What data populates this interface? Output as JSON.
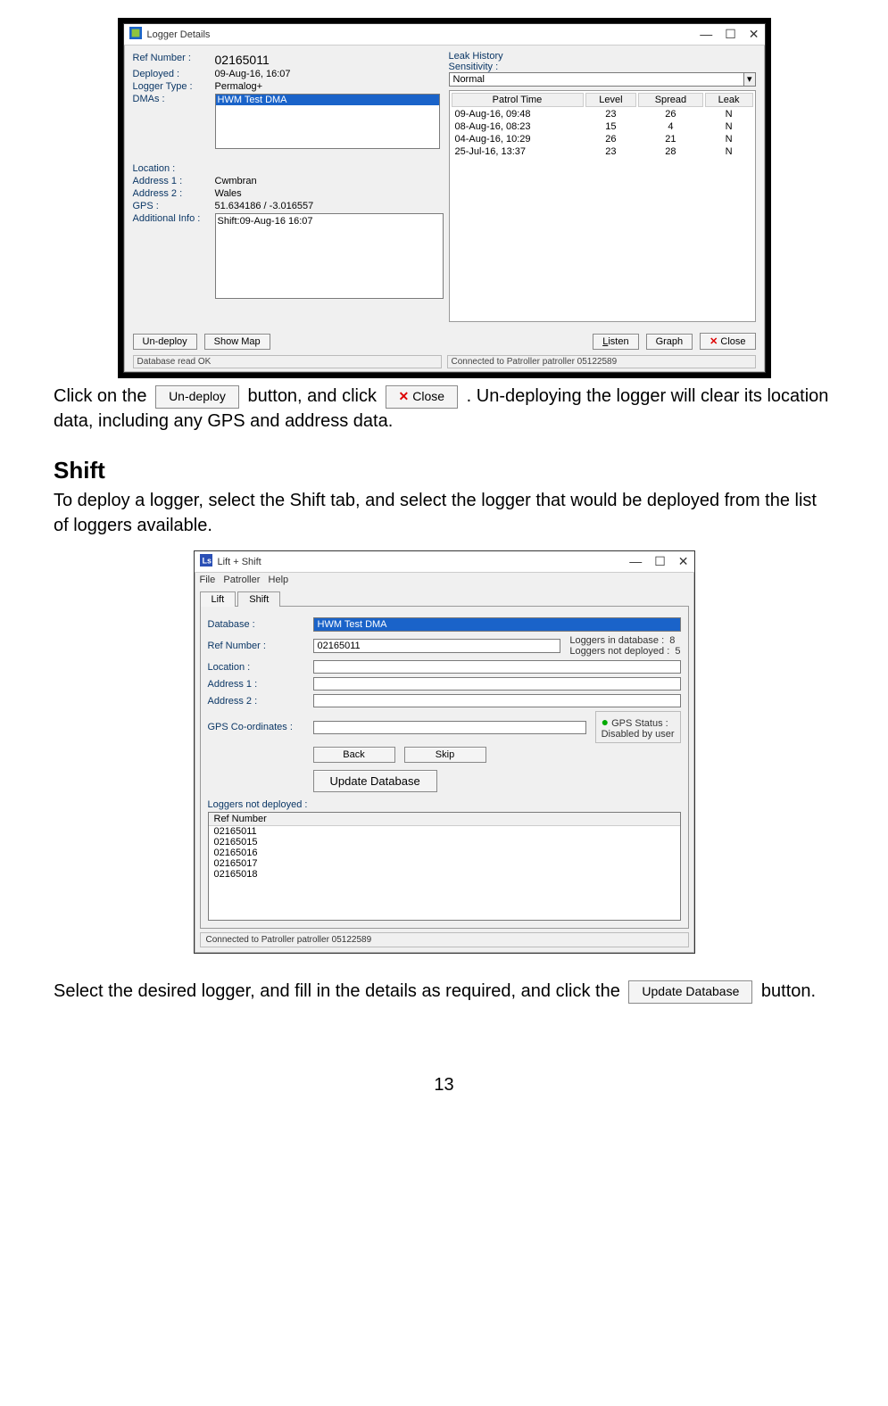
{
  "logger_details": {
    "window_title": "Logger Details",
    "labels": {
      "ref_number": "Ref Number :",
      "deployed": "Deployed :",
      "logger_type": "Logger Type :",
      "dmas": "DMAs :",
      "location": "Location :",
      "address1": "Address 1 :",
      "address2": "Address 2 :",
      "gps": "GPS :",
      "additional_info": "Additional Info :",
      "leak_history": "Leak History",
      "sensitivity": "Sensitivity :"
    },
    "values": {
      "ref_number": "02165011",
      "deployed": "09-Aug-16, 16:07",
      "logger_type": "Permalog+",
      "dma_selected": "HWM Test DMA",
      "address1": "Cwmbran",
      "address2": "Wales",
      "gps": "51.634186 / -3.016557",
      "additional_info": "Shift:09-Aug-16 16:07",
      "sensitivity_value": "Normal"
    },
    "table": {
      "headers": {
        "patrol_time": "Patrol Time",
        "level": "Level",
        "spread": "Spread",
        "leak": "Leak"
      },
      "rows": [
        {
          "time": "09-Aug-16, 09:48",
          "level": "23",
          "spread": "26",
          "leak": "N"
        },
        {
          "time": "08-Aug-16, 08:23",
          "level": "15",
          "spread": "4",
          "leak": "N"
        },
        {
          "time": "04-Aug-16, 10:29",
          "level": "26",
          "spread": "21",
          "leak": "N"
        },
        {
          "time": "25-Jul-16, 13:37",
          "level": "23",
          "spread": "28",
          "leak": "N"
        }
      ]
    },
    "buttons": {
      "undeploy": "Un-deploy",
      "show_map": "Show Map",
      "listen": "Listen",
      "graph": "Graph",
      "close": "Close"
    },
    "status": {
      "left": "Database read OK",
      "right": "Connected to Patroller patroller 05122589"
    }
  },
  "body_text": {
    "p1_a": "Click on the ",
    "p1_b": " button, and click ",
    "p1_c": ". Un-deploying the logger will clear its location data, including any GPS and address data.",
    "inline_undeploy": "Un-deploy",
    "inline_close": "Close",
    "shift_heading": "Shift",
    "p2": "To deploy a logger, select the Shift tab, and select the logger that would be deployed from the list of loggers available.",
    "p3_a": "Select the desired logger, and fill in the details as required, and click the ",
    "p3_b": " button.",
    "inline_update_db": "Update Database",
    "page_number": "13"
  },
  "lift_shift": {
    "window_title": "Lift + Shift",
    "menu": {
      "file": "File",
      "patroller": "Patroller",
      "help": "Help"
    },
    "tabs": {
      "lift": "Lift",
      "shift": "Shift"
    },
    "labels": {
      "database": "Database :",
      "ref_number": "Ref Number :",
      "location": "Location :",
      "address1": "Address 1 :",
      "address2": "Address 2 :",
      "gps": "GPS Co-ordinates :",
      "loggers_in_db": "Loggers in database :",
      "loggers_not_deployed_count": "Loggers not deployed :",
      "gps_status": "GPS Status :",
      "gps_status_value": "Disabled by user",
      "loggers_not_deployed_header": "Loggers not deployed :",
      "list_header": "Ref Number"
    },
    "values": {
      "database": "HWM Test DMA",
      "ref_number": "02165011",
      "loggers_in_db": "8",
      "loggers_not_deployed": "5"
    },
    "buttons": {
      "back": "Back",
      "skip": "Skip",
      "update_db": "Update Database"
    },
    "list_items": [
      "02165011",
      "02165015",
      "02165016",
      "02165017",
      "02165018"
    ],
    "statusbar": "Connected to Patroller patroller 05122589"
  }
}
